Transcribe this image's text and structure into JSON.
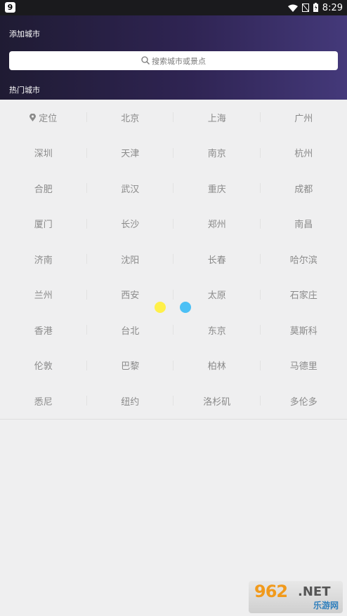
{
  "status_bar": {
    "app_badge": "9",
    "time": "8:29"
  },
  "header": {
    "title": "添加城市",
    "search_placeholder": "搜索城市或景点",
    "section_label": "热门城市"
  },
  "cities": [
    "定位",
    "北京",
    "上海",
    "广州",
    "深圳",
    "天津",
    "南京",
    "杭州",
    "合肥",
    "武汉",
    "重庆",
    "成都",
    "厦门",
    "长沙",
    "郑州",
    "南昌",
    "济南",
    "沈阳",
    "长春",
    "哈尔滨",
    "兰州",
    "西安",
    "太原",
    "石家庄",
    "香港",
    "台北",
    "东京",
    "莫斯科",
    "伦敦",
    "巴黎",
    "柏林",
    "马德里",
    "悉尼",
    "纽约",
    "洛杉矶",
    "多伦多"
  ],
  "watermark": {
    "logo": "962",
    "suffix": ".NET",
    "subtitle": "乐游网"
  }
}
